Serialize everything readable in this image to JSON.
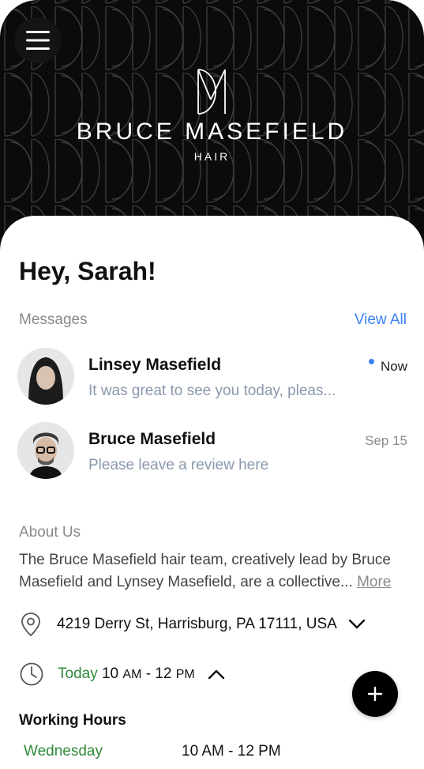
{
  "header": {
    "brand_name": "BRUCE MASEFIELD",
    "brand_sub": "HAIR",
    "menu_icon": "hamburger-menu-icon"
  },
  "greeting": "Hey, Sarah!",
  "messages": {
    "label": "Messages",
    "view_all": "View All",
    "items": [
      {
        "name": "Linsey Masefield",
        "preview": "It was great to see you today, pleas...",
        "time": "Now",
        "unread": true
      },
      {
        "name": "Bruce Masefield",
        "preview": "Please leave a review here",
        "time": "Sep 15",
        "unread": false
      }
    ]
  },
  "about": {
    "label": "About Us",
    "text": "The Bruce Masefield hair team, creatively lead by Bruce Masefield and Lynsey Masefield, are a collective...",
    "more": "More"
  },
  "location": {
    "address": "4219 Derry St, Harrisburg, PA 17111, USA",
    "icon": "location-pin-icon"
  },
  "hours": {
    "today_label": "Today",
    "today_open": "10",
    "today_open_suffix": "AM",
    "today_sep": "-",
    "today_close": "12",
    "today_close_suffix": "PM",
    "icon": "clock-icon",
    "title": "Working Hours",
    "rows": [
      {
        "day": "Wednesday",
        "time": "10 AM - 12 PM"
      }
    ]
  },
  "fab_icon": "plus-icon",
  "colors": {
    "accent_blue": "#3b82f6",
    "today_green": "#2f8a3b",
    "header_bg": "#0b0b0b"
  }
}
